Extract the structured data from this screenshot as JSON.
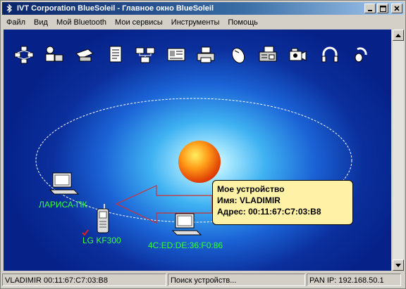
{
  "window": {
    "title": "IVT Corporation BlueSoleil - Главное окно BlueSoleil"
  },
  "menu": [
    "Файл",
    "Вид",
    "Мой Bluetooth",
    "Мои сервисы",
    "Инструменты",
    "Помощь"
  ],
  "toolbar_icons": [
    "network-access-icon",
    "personal-area-network-icon",
    "fax-icon",
    "document-transfer-icon",
    "lan-access-icon",
    "business-card-icon",
    "printer-icon",
    "mouse-icon",
    "fax-printer-icon",
    "camera-icon",
    "headset-icon",
    "headphone-icon"
  ],
  "devices": {
    "pc1": {
      "name": "ЛАРИСА-ПК",
      "icon": "computer-icon"
    },
    "phone": {
      "name": "LG KF300",
      "icon": "mobile-phone-icon"
    },
    "pc2": {
      "name": "4C:ED:DE:36:F0:86",
      "icon": "computer-icon"
    }
  },
  "my_device": {
    "heading": "Мое устройство",
    "name_line": "Имя: VLADIMIR",
    "address_line": "Адрес: 00:11:67:C7:03:B8"
  },
  "status": {
    "device": "VLADIMIR 00:11:67:C7:03:B8",
    "search": "Поиск устройств...",
    "pan_ip": "PAN IP: 192.168.50.1"
  },
  "colors": {
    "device_label": "#39ff39",
    "tooltip_bg": "#fff2a6",
    "title_bar": "#0a246a",
    "arrow": "#d03030"
  }
}
